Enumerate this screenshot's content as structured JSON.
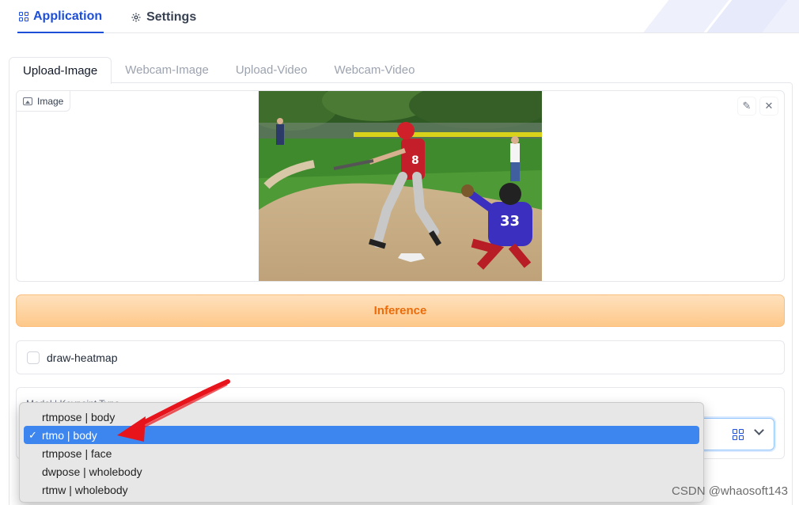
{
  "top_tabs": [
    {
      "label": "Application",
      "icon": "grid-icon",
      "active": true
    },
    {
      "label": "Settings",
      "icon": "gear-icon",
      "active": false
    }
  ],
  "panel_tabs": [
    {
      "label": "Upload-Image",
      "active": true
    },
    {
      "label": "Webcam-Image",
      "active": false
    },
    {
      "label": "Upload-Video",
      "active": false
    },
    {
      "label": "Webcam-Video",
      "active": false
    }
  ],
  "image_box": {
    "label": "Image",
    "label_icon": "image-icon",
    "actions": {
      "edit_icon": "pencil-icon",
      "close_icon": "close-icon"
    }
  },
  "inference_button": {
    "label": "Inference"
  },
  "checkbox": {
    "label": "draw-heatmap",
    "checked": false
  },
  "dropdown": {
    "label": "Model | Keypoint Type",
    "options": [
      {
        "label": "rtmpose | body",
        "selected": false
      },
      {
        "label": "rtmo | body",
        "selected": true
      },
      {
        "label": "rtmpose | face",
        "selected": false
      },
      {
        "label": "dwpose | wholebody",
        "selected": false
      },
      {
        "label": "rtmw | wholebody",
        "selected": false
      }
    ]
  },
  "watermark": "CSDN @whaosoft143",
  "colors": {
    "accent": "#1d4ed8",
    "inference_text": "#ea6c0a",
    "inference_bg": "#fdc88a",
    "selected_option": "#3d86f0",
    "annotation_arrow": "#e8141b"
  }
}
